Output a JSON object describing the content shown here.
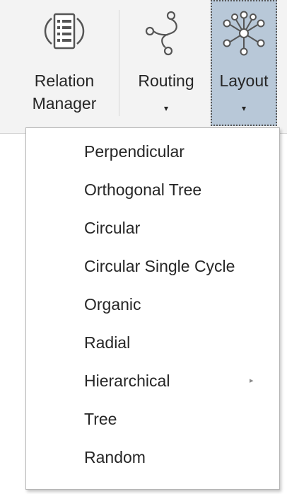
{
  "ribbon": {
    "relation_manager": {
      "line1": "Relation",
      "line2": "Manager",
      "icon": "relation-manager-icon"
    },
    "routing": {
      "label": "Routing",
      "caret": "▾",
      "icon": "routing-icon"
    },
    "layout": {
      "label": "Layout",
      "caret": "▾",
      "icon": "layout-icon",
      "selected_bg": "#b8c8d8"
    }
  },
  "menu": {
    "items": [
      {
        "label": "Perpendicular"
      },
      {
        "label": "Orthogonal Tree"
      },
      {
        "label": "Circular"
      },
      {
        "label": "Circular Single Cycle"
      },
      {
        "label": "Organic"
      },
      {
        "label": "Radial"
      },
      {
        "label": "Hierarchical",
        "submenu_arrow": "▸"
      },
      {
        "label": "Tree"
      },
      {
        "label": "Random"
      }
    ]
  }
}
